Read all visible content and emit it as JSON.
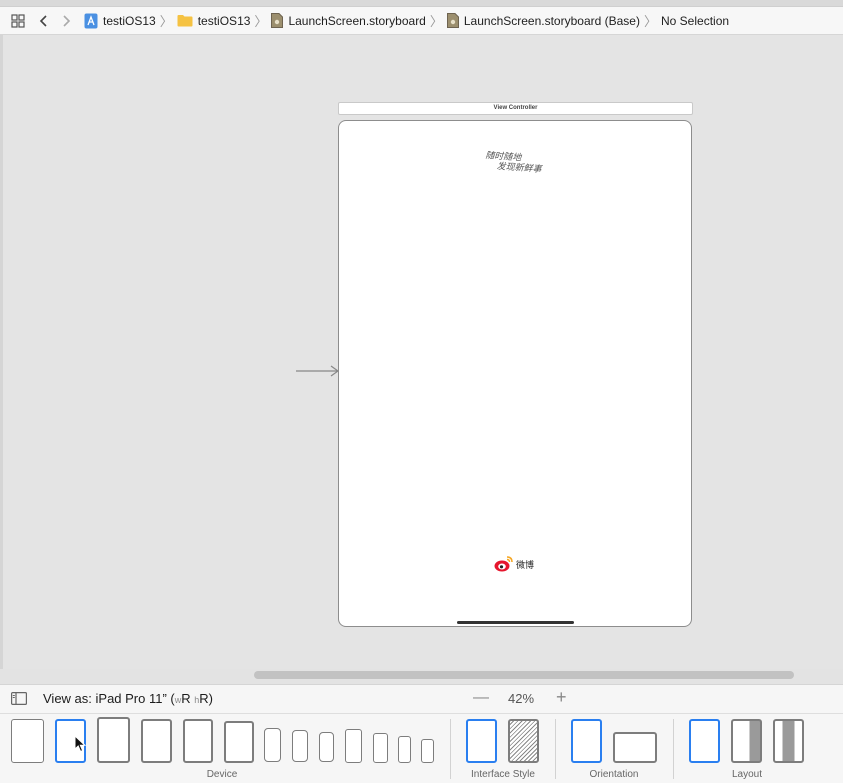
{
  "jumpbar": {
    "crumbs": [
      {
        "label": "testiOS13",
        "icon": "xcode-project-icon"
      },
      {
        "label": "testiOS13",
        "icon": "folder-icon"
      },
      {
        "label": "LaunchScreen.storyboard",
        "icon": "storyboard-file-icon"
      },
      {
        "label": "LaunchScreen.storyboard (Base)",
        "icon": "storyboard-file-icon"
      },
      {
        "label": "No Selection",
        "icon": ""
      }
    ]
  },
  "canvas": {
    "scene_title": "View Controller",
    "slogan_line1": "随时随地",
    "slogan_line2": "发现新鲜事",
    "logo_text": "微博"
  },
  "bottom": {
    "view_as_prefix": "View as: iPad Pro 11” (",
    "w_label": "w",
    "r1": "R ",
    "h_label": "h",
    "r2": "R)",
    "zoom_minus": "—",
    "zoom": "42%",
    "zoom_plus": "+",
    "groups": {
      "device": "Device",
      "interface_style": "Interface Style",
      "orientation": "Orientation",
      "layout": "Layout"
    }
  },
  "colors": {
    "accent": "#2a7ff0",
    "canvas_bg": "#e4e4e4"
  }
}
